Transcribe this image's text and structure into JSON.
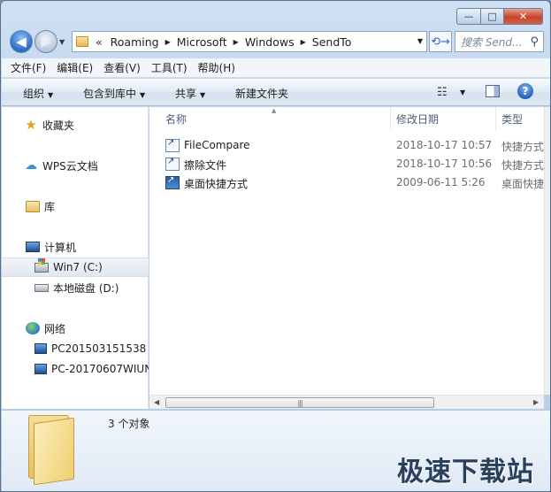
{
  "window": {
    "caption": {
      "minimize": "—",
      "maximize": "□",
      "close": "✕"
    }
  },
  "nav": {
    "back_icon": "◀",
    "forward_icon": "▶",
    "history_drop": "▼"
  },
  "address": {
    "overflow": "«",
    "crumbs": [
      "Roaming",
      "Microsoft",
      "Windows",
      "SendTo"
    ],
    "separator": "▶",
    "drop": "▼",
    "refresh_icon": "⟲→"
  },
  "search": {
    "placeholder": "搜索 Send...",
    "icon": "⚲"
  },
  "menu": [
    "文件(F)",
    "编辑(E)",
    "查看(V)",
    "工具(T)",
    "帮助(H)"
  ],
  "toolbar": {
    "organize": "组织",
    "include_library": "包含到库中",
    "share": "共享",
    "new_folder": "新建文件夹",
    "arrow": "▼",
    "view_icon": "☷",
    "help_icon": "?"
  },
  "sidebar": {
    "favorites": "收藏夹",
    "wps": "WPS云文档",
    "libraries": "库",
    "computer": "计算机",
    "win7": "Win7 (C:)",
    "local_disk": "本地磁盘 (D:)",
    "network": "网络",
    "pc1": "PC201503151538",
    "pc2": "PC-20170607WIUN"
  },
  "columns": {
    "name": "名称",
    "modified": "修改日期",
    "type": "类型",
    "sort_indicator": "▲"
  },
  "files": [
    {
      "name": "FileCompare",
      "date": "2018-10-17 10:57",
      "type": "快捷方式"
    },
    {
      "name": "擦除文件",
      "date": "2018-10-17 10:56",
      "type": "快捷方式"
    },
    {
      "name": "桌面快捷方式",
      "date": "2009-06-11 5:26",
      "type": "桌面快捷"
    }
  ],
  "hscroll": {
    "left": "◀",
    "right": "▶",
    "grip": "|||"
  },
  "status": {
    "count": "3 个对象"
  },
  "watermark": "极速下载站",
  "colors": {
    "selection": "#e2e8f0",
    "accent": "#2a6ac2"
  }
}
